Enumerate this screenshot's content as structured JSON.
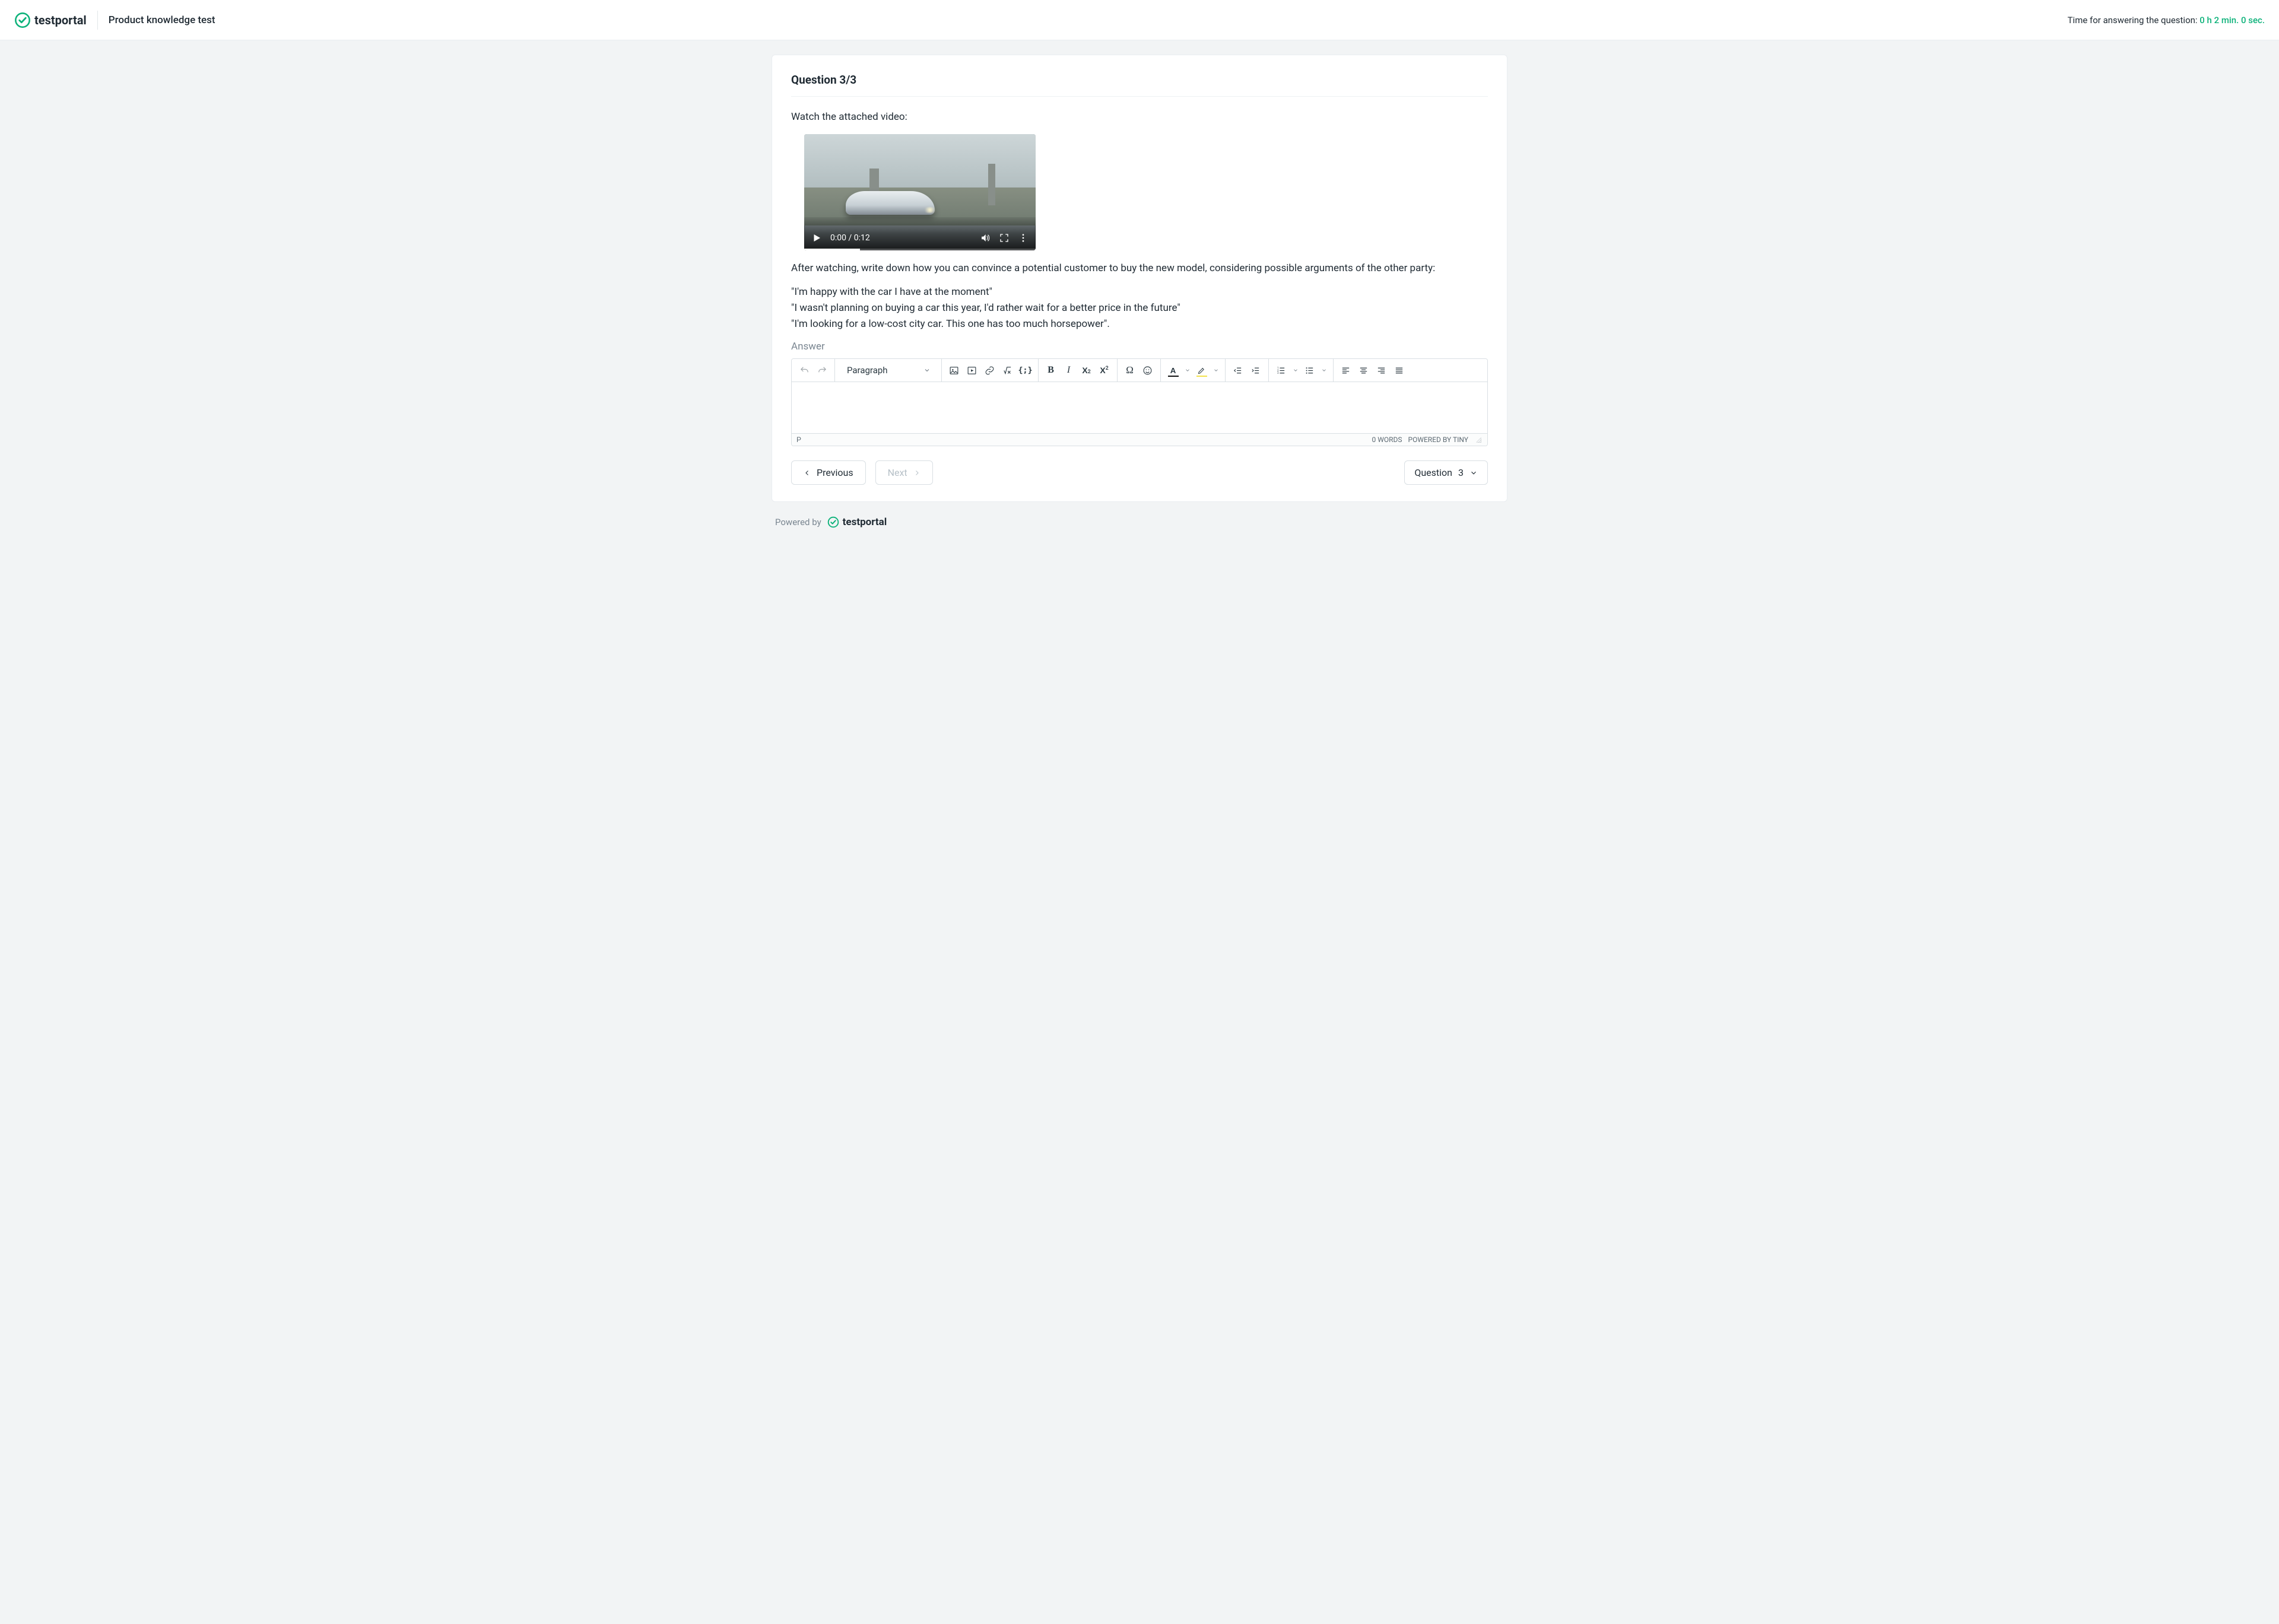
{
  "header": {
    "brand": "testportal",
    "test_title": "Product knowledge test",
    "timer_label": "Time for answering the question:",
    "timer_value": "0 h 2 min. 0 sec."
  },
  "question": {
    "counter": "Question 3/3",
    "intro": "Watch the attached video:",
    "after": "After watching, write down how you can convince a potential customer to buy the new model, considering possible arguments of the other party:",
    "quote1": "\"I'm happy with the car I have at the moment\"",
    "quote2": "\"I wasn't planning on buying a car this year, I'd rather wait for a better price in the future\"",
    "quote3": "\"I'm looking for a low-cost city car. This one has too much horsepower\"."
  },
  "video": {
    "time": "0:00 / 0:12"
  },
  "editor": {
    "answer_label": "Answer",
    "format_value": "Paragraph",
    "status_path": "P",
    "word_count": "0 WORDS",
    "powered": "POWERED BY TINY"
  },
  "nav": {
    "previous": "Previous",
    "next": "Next",
    "question_label": "Question",
    "question_number": "3"
  },
  "footer": {
    "powered_by": "Powered by",
    "brand": "testportal"
  }
}
